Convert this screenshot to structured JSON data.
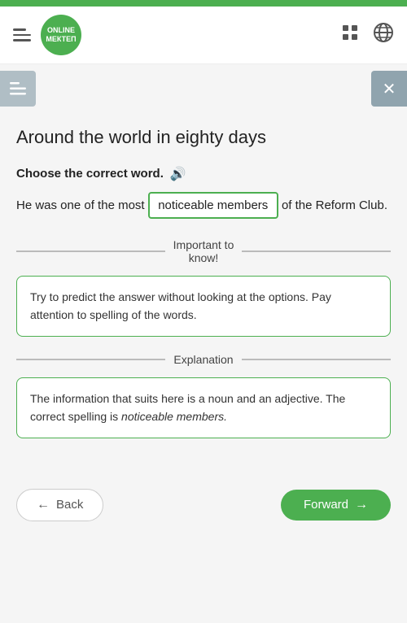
{
  "topBar": {
    "color": "#4caf50"
  },
  "nav": {
    "logo": {
      "line1": "ONLINE",
      "line2": "МЕКТЕП"
    },
    "gridIconLabel": "grid-icon",
    "globeIconLabel": "globe-icon"
  },
  "actionBar": {
    "menuLabel": "☰",
    "closeLabel": "✕"
  },
  "main": {
    "title": "Around the world in eighty days",
    "questionLabel": "Choose the correct word.",
    "soundIconLabel": "🔊",
    "sentencePart1": "He was one of the most",
    "answerBox": "noticeable members",
    "sentencePart2": "of the Reform Club.",
    "importantToKnow": {
      "line1": "Important to",
      "line2": "know!"
    },
    "infoCardText": "Try to predict the answer without looking at the options. Pay attention to spelling of the words.",
    "explanationLabel": "Explanation",
    "explanationCardText1": "The information that suits here is a noun and an adjective. The correct spelling is ",
    "explanationCardItalic": "noticeable members.",
    "backLabel": "Back",
    "forwardLabel": "Forward"
  }
}
